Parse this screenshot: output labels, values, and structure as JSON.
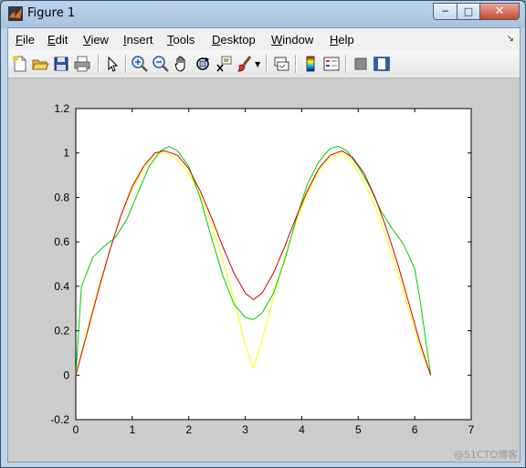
{
  "window": {
    "title": "Figure 1",
    "minimize": "─",
    "maximize": "□",
    "close": "✕"
  },
  "menu": [
    "File",
    "Edit",
    "View",
    "Insert",
    "Tools",
    "Desktop",
    "Window",
    "Help"
  ],
  "menu_access": [
    "F",
    "E",
    "V",
    "I",
    "T",
    "D",
    "W",
    "H"
  ],
  "toolbar": [
    "new-figure",
    "open-file",
    "save-figure",
    "print-figure",
    "edit-plot",
    "zoom-in",
    "zoom-out",
    "pan",
    "rotate-3d",
    "data-cursor",
    "brush",
    "link-plot",
    "insert-colorbar",
    "insert-legend",
    "hide-plot-tools",
    "show-plot-tools"
  ],
  "watermark": "@51CTO博客",
  "chart_data": {
    "type": "line",
    "xlim": [
      0,
      7
    ],
    "ylim": [
      -0.2,
      1.2
    ],
    "xticks": [
      0,
      1,
      2,
      3,
      4,
      5,
      6,
      7
    ],
    "yticks": [
      -0.2,
      0,
      0.2,
      0.4,
      0.6,
      0.8,
      1,
      1.2
    ],
    "ytick_labels": [
      "-0.2",
      "0",
      "0.2",
      "0.4",
      "0.6",
      "0.8",
      "1",
      "1.2"
    ],
    "grid": false,
    "series": [
      {
        "color": "#ffff00",
        "x": [
          0,
          0.2,
          0.4,
          0.6,
          0.8,
          1.0,
          1.2,
          1.4,
          1.571,
          1.8,
          2.0,
          2.2,
          2.4,
          2.6,
          2.8,
          3.0,
          3.142,
          3.3,
          3.5,
          3.7,
          3.9,
          4.1,
          4.3,
          4.5,
          4.712,
          4.9,
          5.1,
          5.3,
          5.5,
          5.7,
          5.9,
          6.1,
          6.283
        ],
        "y": [
          0,
          0.2,
          0.39,
          0.56,
          0.72,
          0.84,
          0.93,
          0.99,
          1.0,
          0.97,
          0.91,
          0.81,
          0.68,
          0.52,
          0.34,
          0.14,
          0.03,
          0.16,
          0.35,
          0.53,
          0.69,
          0.82,
          0.92,
          0.98,
          1.0,
          0.95,
          0.87,
          0.76,
          0.62,
          0.46,
          0.29,
          0.12,
          0.0
        ]
      },
      {
        "color": "#00cc00",
        "x": [
          0,
          0.1,
          0.3,
          0.5,
          0.7,
          0.9,
          1.1,
          1.3,
          1.5,
          1.65,
          1.8,
          2.0,
          2.2,
          2.4,
          2.6,
          2.8,
          3.0,
          3.142,
          3.3,
          3.5,
          3.7,
          3.9,
          4.1,
          4.3,
          4.5,
          4.65,
          4.8,
          5.0,
          5.2,
          5.4,
          5.6,
          5.8,
          6.0,
          6.1,
          6.283
        ],
        "y": [
          0,
          0.4,
          0.53,
          0.58,
          0.62,
          0.7,
          0.82,
          0.94,
          1.01,
          1.03,
          1.01,
          0.94,
          0.8,
          0.62,
          0.45,
          0.32,
          0.26,
          0.25,
          0.28,
          0.37,
          0.52,
          0.7,
          0.86,
          0.96,
          1.02,
          1.03,
          1.01,
          0.94,
          0.85,
          0.74,
          0.66,
          0.59,
          0.48,
          0.33,
          0.0
        ]
      },
      {
        "color": "#cc0000",
        "x": [
          0,
          0.2,
          0.4,
          0.6,
          0.8,
          1.0,
          1.2,
          1.4,
          1.571,
          1.8,
          2.0,
          2.2,
          2.4,
          2.6,
          2.8,
          3.0,
          3.142,
          3.3,
          3.5,
          3.7,
          3.9,
          4.1,
          4.3,
          4.5,
          4.712,
          4.9,
          5.1,
          5.3,
          5.5,
          5.7,
          5.9,
          6.1,
          6.283
        ],
        "y": [
          0,
          0.19,
          0.38,
          0.56,
          0.72,
          0.85,
          0.94,
          1.0,
          1.01,
          0.99,
          0.93,
          0.83,
          0.71,
          0.58,
          0.46,
          0.37,
          0.34,
          0.37,
          0.46,
          0.58,
          0.71,
          0.83,
          0.93,
          0.99,
          1.01,
          0.98,
          0.91,
          0.8,
          0.66,
          0.5,
          0.32,
          0.14,
          0.0
        ]
      }
    ]
  }
}
